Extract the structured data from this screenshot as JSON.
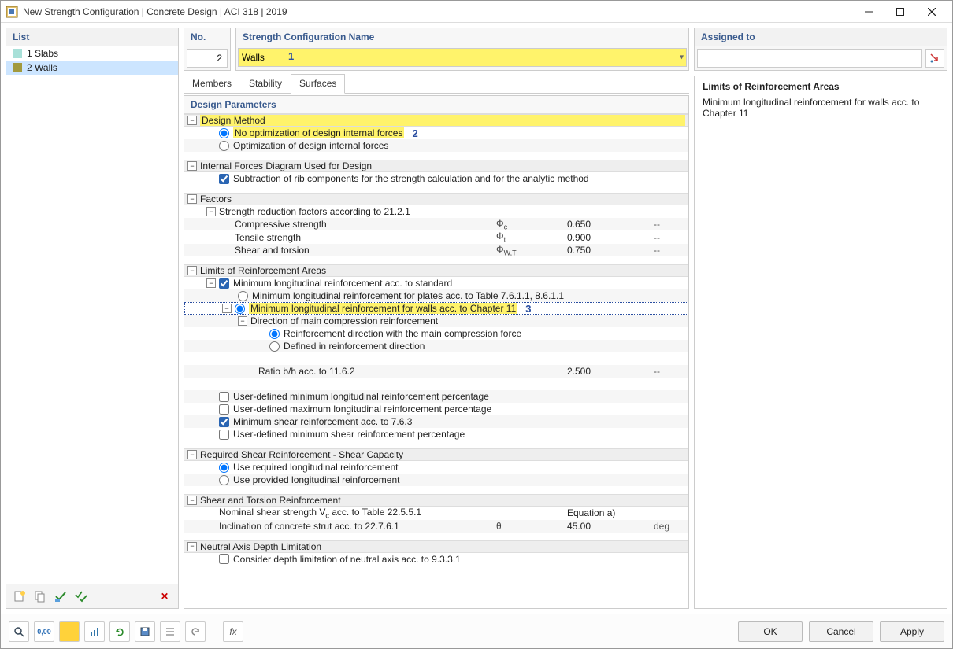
{
  "window": {
    "title": "New Strength Configuration | Concrete Design | ACI 318 | 2019"
  },
  "left": {
    "header": "List",
    "items": [
      {
        "text": "1 Slabs",
        "selected": false,
        "color": "teal"
      },
      {
        "text": "2 Walls",
        "selected": true,
        "color": "olive"
      }
    ]
  },
  "no_field": {
    "label": "No.",
    "value": "2"
  },
  "name_field": {
    "label": "Strength Configuration Name",
    "value": "Walls",
    "annotation": "1"
  },
  "assigned": {
    "label": "Assigned to",
    "value": ""
  },
  "tabs": [
    "Members",
    "Stability",
    "Surfaces"
  ],
  "active_tab": "Surfaces",
  "right_panel": {
    "title": "Limits of Reinforcement Areas",
    "desc": "Minimum longitudinal reinforcement for walls acc. to Chapter 11"
  },
  "dp_title": "Design Parameters",
  "annotations": {
    "opt2": "2",
    "opt3": "3"
  },
  "dm": {
    "header": "Design Method",
    "opt1": "No optimization of design internal forces",
    "opt2": "Optimization of design internal forces"
  },
  "ifd": {
    "header": "Internal Forces Diagram Used for Design",
    "opt1": "Subtraction of rib components for the strength calculation and for the analytic method"
  },
  "factors": {
    "header": "Factors",
    "sub": "Strength reduction factors according to 21.2.1",
    "rows": [
      {
        "label": "Compressive strength",
        "sym": "Φc",
        "val": "0.650",
        "unit": "--"
      },
      {
        "label": "Tensile strength",
        "sym": "Φt",
        "val": "0.900",
        "unit": "--"
      },
      {
        "label": "Shear and torsion",
        "sym": "ΦW,T",
        "val": "0.750",
        "unit": "--"
      }
    ]
  },
  "limits": {
    "header": "Limits of Reinforcement Areas",
    "chk1": "Minimum longitudinal reinforcement acc. to standard",
    "r1": "Minimum longitudinal reinforcement for plates acc. to Table 7.6.1.1, 8.6.1.1",
    "r2": "Minimum longitudinal reinforcement for walls acc. to Chapter 11",
    "dir_hdr": "Direction of main compression reinforcement",
    "dir_r1": "Reinforcement direction with the main compression force",
    "dir_r2": "Defined in reinforcement direction",
    "ratio_label": "Ratio b/h acc. to 11.6.2",
    "ratio_val": "2.500",
    "ratio_unit": "--",
    "chk_ud_min_long": "User-defined minimum longitudinal reinforcement percentage",
    "chk_ud_max_long": "User-defined maximum longitudinal reinforcement percentage",
    "chk_min_shear": "Minimum shear reinforcement acc. to 7.6.3",
    "chk_ud_min_shear": "User-defined minimum shear reinforcement percentage"
  },
  "shear_cap": {
    "header": "Required Shear Reinforcement - Shear Capacity",
    "r1": "Use required longitudinal reinforcement",
    "r2": "Use provided longitudinal reinforcement"
  },
  "shear_tor": {
    "header": "Shear and Torsion Reinforcement",
    "row1_label": "Nominal shear strength Vc acc. to Table 22.5.5.1",
    "row1_val": "Equation a)",
    "row2_label": "Inclination of concrete strut acc. to 22.7.6.1",
    "row2_sym": "θ",
    "row2_val": "45.00",
    "row2_unit": "deg"
  },
  "neutral": {
    "header": "Neutral Axis Depth Limitation",
    "chk": "Consider depth limitation of neutral axis acc. to 9.3.3.1"
  },
  "buttons": {
    "ok": "OK",
    "cancel": "Cancel",
    "apply": "Apply"
  }
}
